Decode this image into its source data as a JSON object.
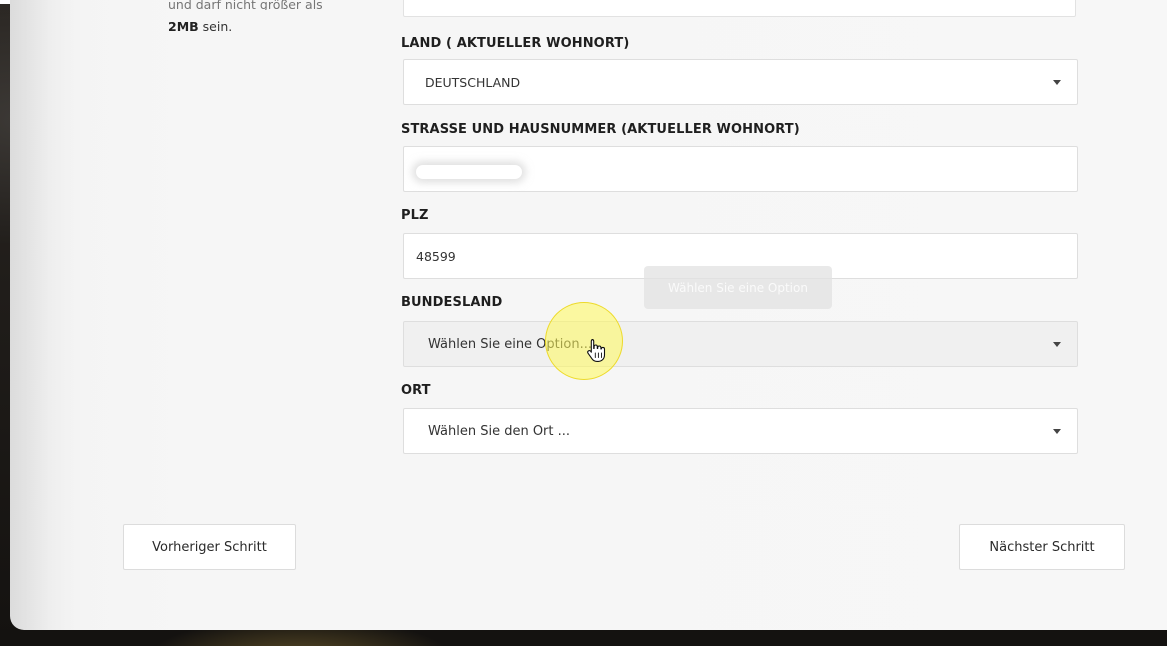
{
  "sidebar_hint": {
    "cut_text": "und darf nicht größer als",
    "bold": "2MB",
    "rest": " sein."
  },
  "form": {
    "land": {
      "label": "LAND ( AKTUELLER WOHNORT)",
      "value": "DEUTSCHLAND"
    },
    "strasse": {
      "label": "STRASSE UND HAUSNUMMER (AKTUELLER WOHNORT)",
      "value": ""
    },
    "plz": {
      "label": "PLZ",
      "value": "48599"
    },
    "bundesland": {
      "label": "BUNDESLAND",
      "placeholder": "Wählen Sie eine Option...",
      "tooltip": "Wählen Sie eine Option"
    },
    "ort": {
      "label": "ORT",
      "placeholder": "Wählen Sie den Ort ..."
    }
  },
  "buttons": {
    "prev": "Vorheriger Schritt",
    "next": "Nächster Schritt"
  },
  "icons": {
    "dropdown": "chevron-down-icon",
    "cursor": "hand-pointer-icon"
  },
  "colors": {
    "highlight": "#fff85a",
    "card": "#f6f6f6",
    "backdrop": "#1d1a17"
  }
}
